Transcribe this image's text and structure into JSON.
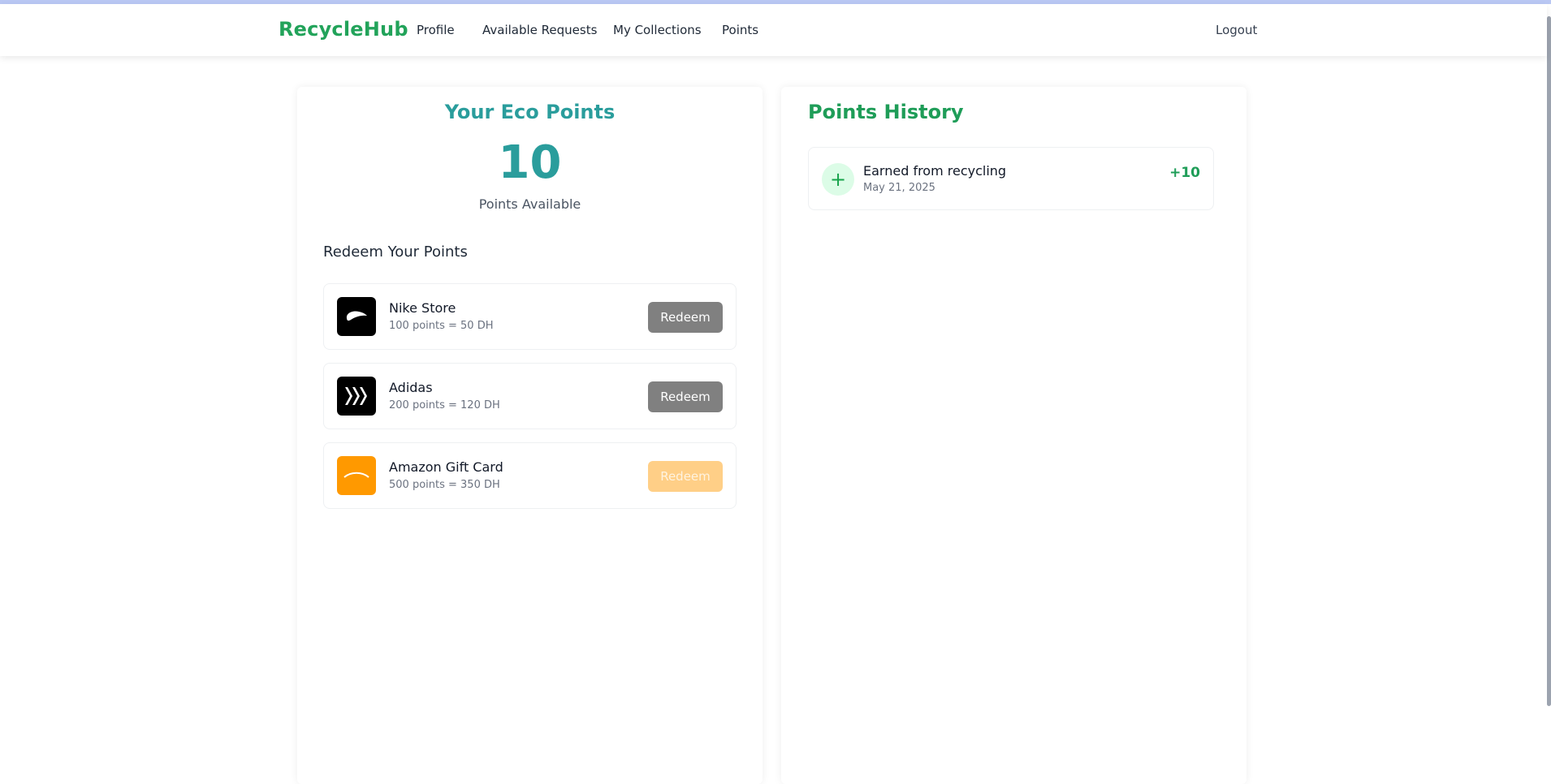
{
  "navbar": {
    "brand": "RecycleHub",
    "links": [
      "Profile",
      "Available Requests",
      "My Collections",
      "Points"
    ],
    "logout": "Logout"
  },
  "eco_points": {
    "title": "Your Eco Points",
    "value": "10",
    "subtitle": "Points Available"
  },
  "redeem": {
    "heading": "Redeem Your Points",
    "items": [
      {
        "name": "Nike Store",
        "desc": "100 points = 50 DH",
        "button": "Redeem",
        "icon": "nike-swoosh-icon",
        "logo_color": "#000000"
      },
      {
        "name": "Adidas",
        "desc": "200 points = 120 DH",
        "button": "Redeem",
        "icon": "adidas-stripes-icon",
        "logo_color": "#000000"
      },
      {
        "name": "Amazon Gift Card",
        "desc": "500 points = 350 DH",
        "button": "Redeem",
        "icon": "amazon-smile-icon",
        "logo_color": "#ff9900"
      }
    ]
  },
  "history": {
    "title": "Points History",
    "items": [
      {
        "label": "Earned from recycling",
        "date": "May 21, 2025",
        "amount": "+10",
        "icon": "plus-icon"
      }
    ]
  },
  "colors": {
    "brand": "#22a35a",
    "teal": "#2a9d9c",
    "history_green": "#1f9d58",
    "button_gray": "#808080",
    "button_disabled_orange": "#ffcf87"
  }
}
